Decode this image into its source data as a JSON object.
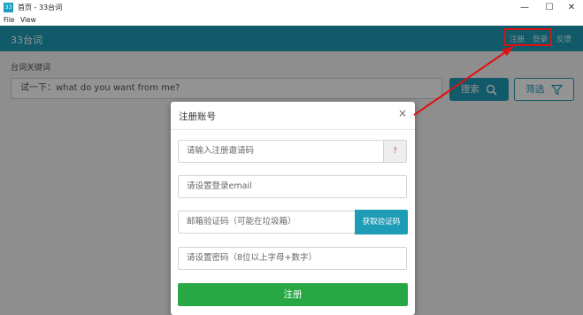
{
  "window": {
    "icon_text": "33",
    "title": "首页 - 33台词",
    "controls": {
      "minimize": "—",
      "maximize": "☐",
      "close": "✕"
    }
  },
  "menubar": {
    "items": [
      "File",
      "View"
    ]
  },
  "navbar": {
    "brand": "33台词",
    "links": {
      "register": "注册",
      "login": "登录",
      "feedback": "反馈"
    }
  },
  "search": {
    "label": "台词关键词",
    "value": "试一下：what do you want from me?",
    "search_button": "搜索",
    "filter_button": "筛选"
  },
  "modal": {
    "title": "注册账号",
    "close": "×",
    "invite_placeholder": "请输入注册邀请码",
    "invite_help": "?",
    "email_placeholder": "请设置登录email",
    "code_placeholder": "邮箱验证码（可能在垃圾箱）",
    "get_code_button": "获取验证码",
    "password_placeholder": "请设置密码（8位以上字母+数字）",
    "submit_button": "注册"
  },
  "colors": {
    "accent": "#1e9bb5",
    "submit": "#28a745",
    "annotation": "#e01010"
  }
}
